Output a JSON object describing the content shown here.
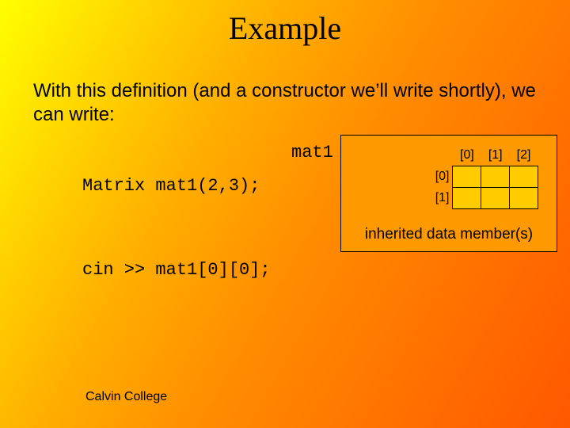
{
  "title": "Example",
  "body_text": "With this definition (and a constructor we’ll write shortly), we can write:",
  "code": {
    "line1": "Matrix mat1(2,3);",
    "line2": "cin >> mat1[0][0];"
  },
  "diagram": {
    "var_label": "mat1",
    "col_headers": [
      "[0]",
      "[1]",
      "[2]"
    ],
    "row_labels": [
      "[0]",
      "[1]"
    ],
    "caption": "inherited data member(s)"
  },
  "footer": "Calvin College"
}
